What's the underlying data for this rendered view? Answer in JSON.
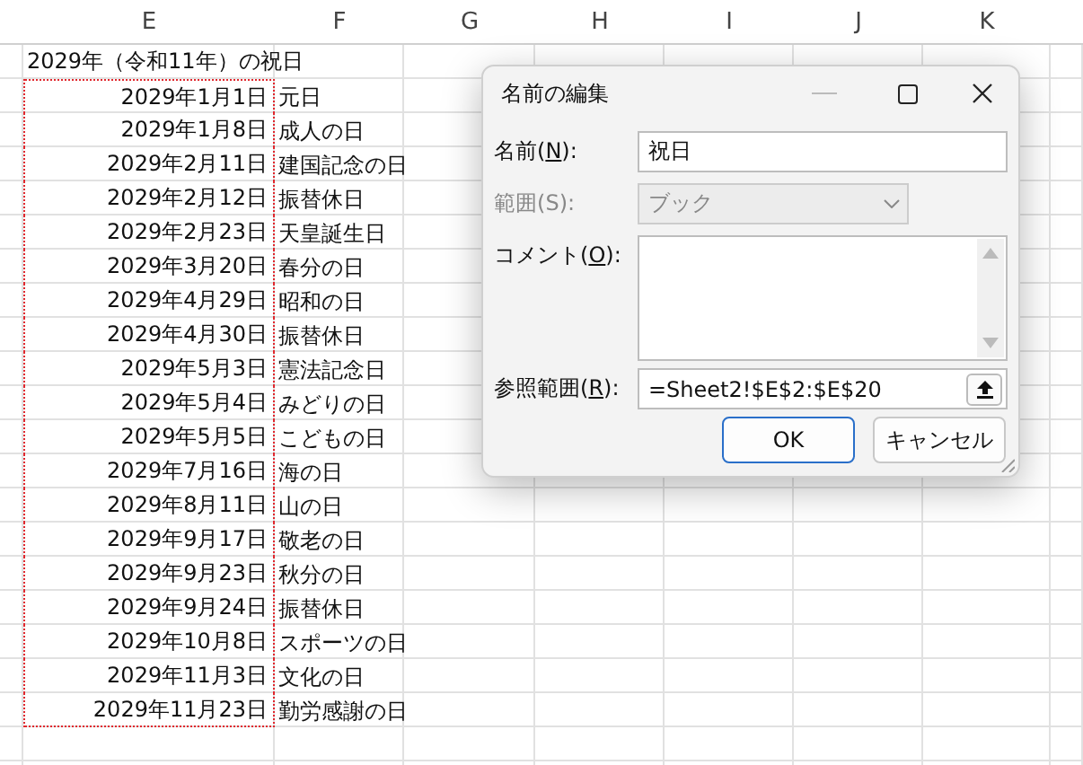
{
  "sheet": {
    "columns": [
      "",
      "E",
      "F",
      "G",
      "H",
      "I",
      "J",
      "K",
      ""
    ],
    "rows": [
      {
        "cells": [
          "",
          "2029年（令和11年）の祝日"
        ],
        "marked": false
      },
      {
        "cells": [
          "",
          "2029年1月1日",
          "元日"
        ],
        "marked": true
      },
      {
        "cells": [
          "",
          "2029年1月8日",
          "成人の日"
        ],
        "marked": true
      },
      {
        "cells": [
          "",
          "2029年2月11日",
          "建国記念の日"
        ],
        "marked": true
      },
      {
        "cells": [
          "",
          "2029年2月12日",
          "振替休日"
        ],
        "marked": true
      },
      {
        "cells": [
          "",
          "2029年2月23日",
          "天皇誕生日"
        ],
        "marked": true
      },
      {
        "cells": [
          "",
          "2029年3月20日",
          "春分の日"
        ],
        "marked": true
      },
      {
        "cells": [
          "",
          "2029年4月29日",
          "昭和の日"
        ],
        "marked": true
      },
      {
        "cells": [
          "",
          "2029年4月30日",
          "振替休日"
        ],
        "marked": true
      },
      {
        "cells": [
          "",
          "2029年5月3日",
          "憲法記念日"
        ],
        "marked": true
      },
      {
        "cells": [
          "",
          "2029年5月4日",
          "みどりの日"
        ],
        "marked": true
      },
      {
        "cells": [
          "",
          "2029年5月5日",
          "こどもの日"
        ],
        "marked": true
      },
      {
        "cells": [
          "",
          "2029年7月16日",
          "海の日"
        ],
        "marked": true
      },
      {
        "cells": [
          "",
          "2029年8月11日",
          "山の日"
        ],
        "marked": true
      },
      {
        "cells": [
          "",
          "2029年9月17日",
          "敬老の日"
        ],
        "marked": true
      },
      {
        "cells": [
          "",
          "2029年9月23日",
          "秋分の日"
        ],
        "marked": true
      },
      {
        "cells": [
          "",
          "2029年9月24日",
          "振替休日"
        ],
        "marked": true
      },
      {
        "cells": [
          "",
          "2029年10月8日",
          "スポーツの日"
        ],
        "marked": true
      },
      {
        "cells": [
          "",
          "2029年11月3日",
          "文化の日"
        ],
        "marked": true
      },
      {
        "cells": [
          "",
          "2029年11月23日",
          "勤労感謝の日"
        ],
        "marked": true
      }
    ]
  },
  "dialog": {
    "title": "名前の編集",
    "fields": [
      {
        "kind": "text",
        "label": {
          "before": "名前(",
          "key": "N",
          "after": "):"
        },
        "value": "祝日",
        "disabled": false
      },
      {
        "kind": "dropdown",
        "label": {
          "before": "範囲(",
          "key": "S",
          "after": "):"
        },
        "value": "ブック",
        "disabled": true
      },
      {
        "kind": "textarea",
        "label": {
          "before": "コメント(",
          "key": "O",
          "after": "):"
        },
        "disabled": false
      },
      {
        "kind": "reference",
        "label": {
          "before": "参照範囲(",
          "key": "R",
          "after": "):"
        },
        "value": "=Sheet2!$E$2:$E$20",
        "disabled": false
      }
    ],
    "buttons": [
      {
        "label": "OK",
        "default": true
      },
      {
        "label": "キャンセル",
        "default": false
      }
    ]
  }
}
